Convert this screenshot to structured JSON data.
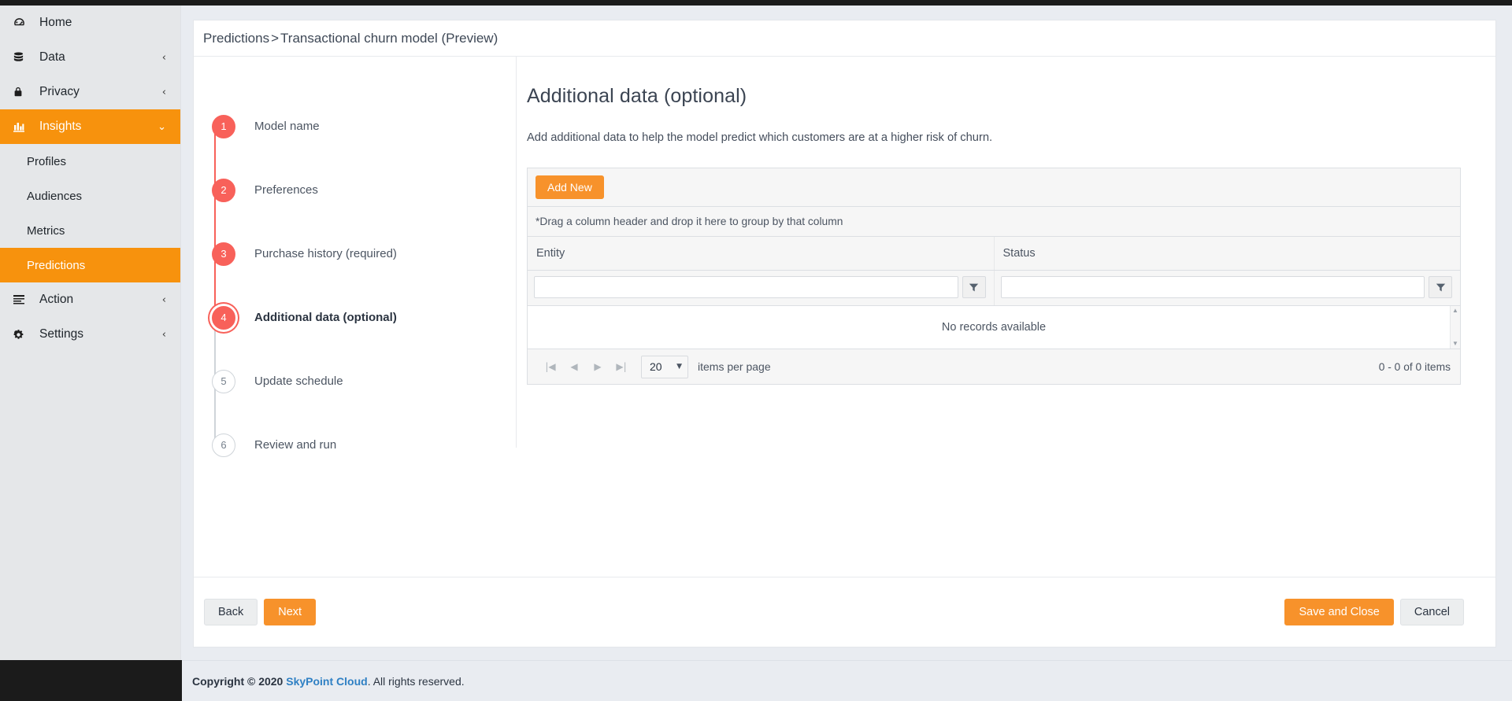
{
  "sidebar": {
    "items": [
      {
        "label": "Home",
        "icon": "dashboard-icon",
        "chevron": "",
        "active": false,
        "sub": false
      },
      {
        "label": "Data",
        "icon": "database-icon",
        "chevron": "‹",
        "active": false,
        "sub": false
      },
      {
        "label": "Privacy",
        "icon": "lock-icon",
        "chevron": "‹",
        "active": false,
        "sub": false
      },
      {
        "label": "Insights",
        "icon": "chart-bar-icon",
        "chevron": "⌄",
        "active": true,
        "sub": false
      },
      {
        "label": "Profiles",
        "icon": "",
        "chevron": "",
        "active": false,
        "sub": true
      },
      {
        "label": "Audiences",
        "icon": "",
        "chevron": "",
        "active": false,
        "sub": true
      },
      {
        "label": "Metrics",
        "icon": "",
        "chevron": "",
        "active": false,
        "sub": true
      },
      {
        "label": "Predictions",
        "icon": "",
        "chevron": "",
        "active": true,
        "sub": true
      },
      {
        "label": "Action",
        "icon": "list-icon",
        "chevron": "‹",
        "active": false,
        "sub": false
      },
      {
        "label": "Settings",
        "icon": "gear-icon",
        "chevron": "‹",
        "active": false,
        "sub": false
      }
    ]
  },
  "breadcrumb": {
    "root": "Predictions",
    "separator": ">",
    "current": "Transactional churn model (Preview)"
  },
  "stepper": {
    "steps": [
      {
        "number": "1",
        "label": "Model name",
        "state": "done"
      },
      {
        "number": "2",
        "label": "Preferences",
        "state": "done"
      },
      {
        "number": "3",
        "label": "Purchase history (required)",
        "state": "done"
      },
      {
        "number": "4",
        "label": "Additional data (optional)",
        "state": "current"
      },
      {
        "number": "5",
        "label": "Update schedule",
        "state": "todo"
      },
      {
        "number": "6",
        "label": "Review and run",
        "state": "todo"
      }
    ]
  },
  "content": {
    "title": "Additional data (optional)",
    "description": "Add additional data to help the model predict which customers are at a higher risk of churn.",
    "grid": {
      "add_new_label": "Add New",
      "group_hint": "*Drag a column header and drop it here to group by that column",
      "columns": [
        {
          "header": "Entity",
          "filter_value": "",
          "filter_icon": "filter-icon"
        },
        {
          "header": "Status",
          "filter_value": "",
          "filter_icon": "filter-icon"
        }
      ],
      "rows": [],
      "empty_message": "No records available",
      "pager": {
        "first_icon": "page-first-icon",
        "prev_icon": "page-prev-icon",
        "next_icon": "page-next-icon",
        "last_icon": "page-last-icon",
        "page_size": "20",
        "page_size_label": "items per page",
        "count_text": "0 - 0 of 0 items"
      }
    }
  },
  "actions": {
    "back": "Back",
    "next": "Next",
    "save_and_close": "Save and Close",
    "cancel": "Cancel"
  },
  "footer": {
    "copyright": "Copyright © 2020",
    "brand": "SkyPoint Cloud",
    "rights": ". All rights reserved."
  },
  "colors": {
    "accent_orange": "#f7920d",
    "button_orange": "#f7922b",
    "step_red": "#f8615a",
    "brand_blue": "#2f80c4",
    "page_bg": "#e9ecf1",
    "sidebar_bg": "#e5e7e9"
  }
}
